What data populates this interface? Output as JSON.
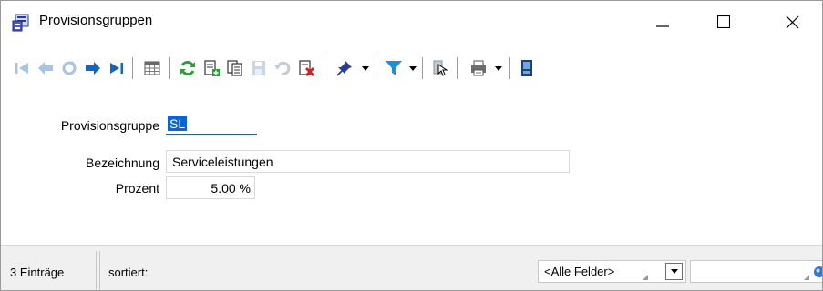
{
  "window": {
    "title": "Provisionsgruppen"
  },
  "titlebar_controls": {
    "minimize": "minimize-icon",
    "maximize": "maximize-icon",
    "close": "close-icon"
  },
  "toolbar": {
    "buttons": [
      "first-record-icon",
      "previous-record-icon",
      "refresh-disabled-icon",
      "next-record-icon",
      "last-record-icon",
      "table-view-icon",
      "reload-icon",
      "new-record-icon",
      "copy-record-icon",
      "save-icon",
      "undo-icon",
      "delete-icon",
      "pin-icon",
      "filter-icon",
      "export-icon",
      "print-icon",
      "exit-icon"
    ]
  },
  "form": {
    "provisionsgruppe_label": "Provisionsgruppe",
    "provisionsgruppe_value": "SL",
    "bezeichnung_label": "Bezeichnung",
    "bezeichnung_value": "Serviceleistungen",
    "prozent_label": "Prozent",
    "prozent_value": "5.00 %"
  },
  "statusbar": {
    "count": "3 Einträge",
    "sort_label": "sortiert:",
    "field_select": "<Alle Felder>",
    "search_value": ""
  },
  "colors": {
    "accent": "#0a64d8",
    "nav_blue": "#1565c0",
    "reload_green": "#2e9e38",
    "delete_red": "#d42020"
  }
}
